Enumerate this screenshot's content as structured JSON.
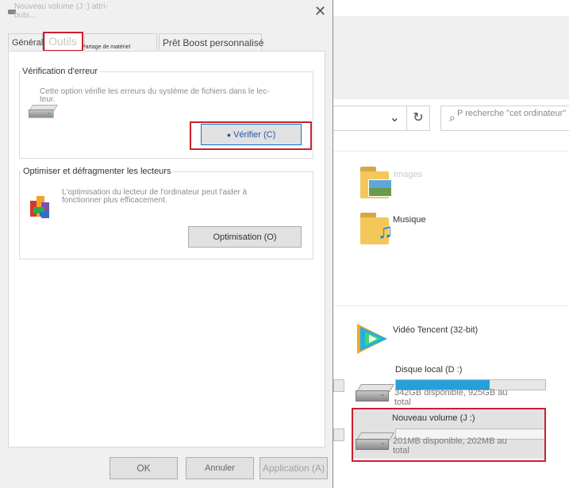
{
  "dialog": {
    "title": "Nouveau volume (J :) attri-",
    "title_line2": "buts...",
    "tabs": {
      "general": "Général",
      "tools": "Outils",
      "hardware_small": "Partage de matériel",
      "boost": "Prêt Boost personnalisé"
    },
    "error_check": {
      "legend": "Vérification d'erreur",
      "description": "Cette option vérifie les erreurs du système de fichiers dans le lec-teur.",
      "button": "Vérifier (C)"
    },
    "optimize": {
      "legend": "Optimiser et défragmenter les lecteurs",
      "description": "L'optimisation du lecteur de l'ordinateur peut l'aider à fonctionner plus efficacement.",
      "button": "Optimisation (O)"
    },
    "footer": {
      "ok": "OK",
      "cancel": "Annuler",
      "apply": "Application (A)"
    }
  },
  "explorer": {
    "search_placeholder": "P recherche \"cet ordinateur\"",
    "folders": [
      {
        "name": "Images"
      },
      {
        "name": "Musique"
      }
    ],
    "apps": [
      {
        "name": "Vidéo Tencent (32-bit)"
      }
    ],
    "drives": [
      {
        "name": "Disque local (D :)",
        "free": "342GB disponible, 925GB au total",
        "used_fraction": 0.63
      },
      {
        "name": "Nouveau volume (J :)",
        "free": "201MB disponible, 202MB au total",
        "used_fraction": 0.0
      }
    ]
  },
  "colors": {
    "highlight": "#c9202e",
    "progress": "#26a0da",
    "accent": "#0078d7"
  }
}
